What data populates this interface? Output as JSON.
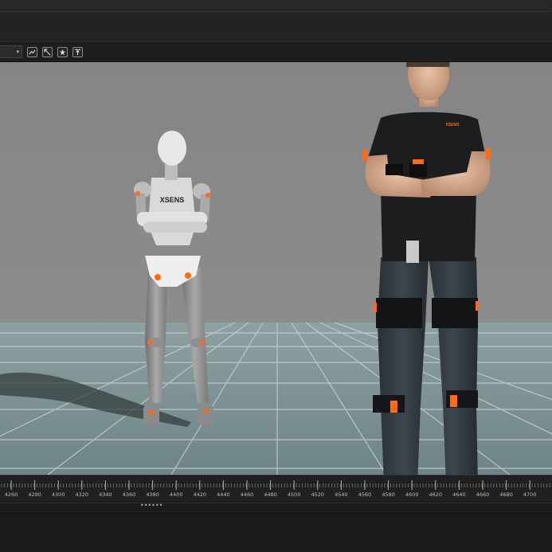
{
  "toolbar": {
    "dropdown_arrow": "▾",
    "buttons": [
      {
        "name": "graph-icon"
      },
      {
        "name": "cursor-icon"
      },
      {
        "name": "star-icon"
      },
      {
        "name": "upload-icon"
      }
    ]
  },
  "viewport": {
    "mannequin_brand": "XSENS",
    "suit_brand": "XSENS"
  },
  "timeline": {
    "ticks": [
      "4260",
      "4280",
      "4300",
      "4320",
      "4340",
      "4360",
      "4380",
      "4400",
      "4420",
      "4440",
      "4460",
      "4480",
      "4500",
      "4520",
      "4540",
      "4560",
      "4580",
      "4600",
      "4620",
      "4640",
      "4660",
      "4680",
      "4700"
    ],
    "handle_dots": "••••••"
  },
  "colors": {
    "accent": "#ff6a13",
    "background_sky": "#8a8a8a",
    "floor": "#7d9294"
  }
}
